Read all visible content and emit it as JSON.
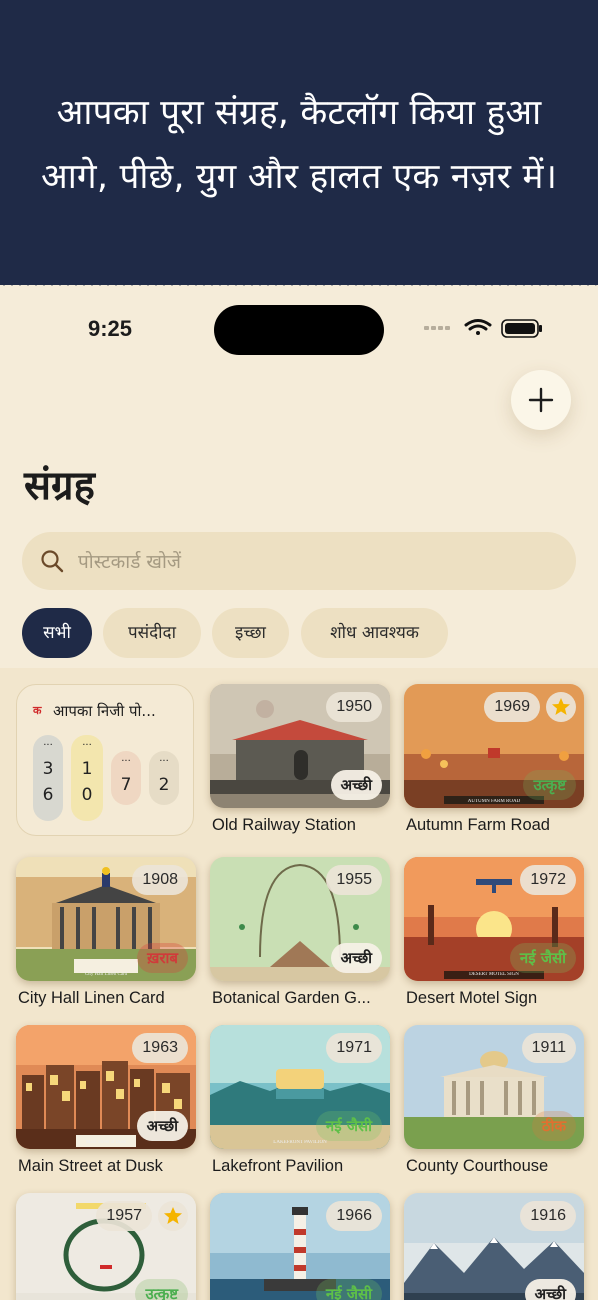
{
  "banner": {
    "line1": "आपका पूरा संग्रह, कैटलॉग किया हुआ",
    "line2": "आगे, पीछे, युग और हालत एक नज़र में।"
  },
  "status_bar": {
    "time": "9:25"
  },
  "header": {
    "title": "संग्रह",
    "add_icon": "plus-icon"
  },
  "search": {
    "placeholder": "पोस्टकार्ड खोजें",
    "value": "",
    "icon": "search-icon"
  },
  "filters": [
    {
      "label": "सभी",
      "active": true
    },
    {
      "label": "पसंदीदा",
      "active": false
    },
    {
      "label": "इच्छा",
      "active": false
    },
    {
      "label": "शोध आवश्यक",
      "active": false
    }
  ],
  "widget": {
    "glyph": "क",
    "title": "आपका निजी पो...",
    "pills": [
      {
        "top": "...",
        "a": "3",
        "b": "6",
        "color": "#d8d8d0"
      },
      {
        "top": "...",
        "a": "1",
        "b": "0",
        "color": "#f3e6ae"
      },
      {
        "top": "...",
        "a": "7",
        "b": "",
        "color": "#efd7c2"
      },
      {
        "top": "...",
        "a": "2",
        "b": "",
        "color": "#e6dcc6"
      }
    ]
  },
  "cards": [
    {
      "title": "Old Railway Station",
      "year": "1950",
      "condition": "अच्छी",
      "condition_type": "good",
      "favorite": false,
      "scene": "railway"
    },
    {
      "title": "Autumn Farm Road",
      "year": "1969",
      "condition": "उत्कृष्ट",
      "condition_type": "excellent",
      "favorite": true,
      "scene": "farm",
      "caption": "AUTUMN FARM ROAD"
    },
    {
      "title": "City Hall Linen Card",
      "year": "1908",
      "condition": "ख़राब",
      "condition_type": "poor",
      "favorite": false,
      "scene": "cityhall",
      "caption": "City Hall Linen Card"
    },
    {
      "title": "Botanical Garden G...",
      "year": "1955",
      "condition": "अच्छी",
      "condition_type": "good",
      "favorite": false,
      "scene": "garden"
    },
    {
      "title": "Desert Motel Sign",
      "year": "1972",
      "condition": "नई जैसी",
      "condition_type": "mint",
      "favorite": false,
      "scene": "desert",
      "caption": "DESERT MOTEL SIGN"
    },
    {
      "title": "Main Street at Dusk",
      "year": "1963",
      "condition": "अच्छी",
      "condition_type": "good",
      "favorite": false,
      "scene": "mainstreet",
      "caption": "Main Street at Dusk"
    },
    {
      "title": "Lakefront Pavilion",
      "year": "1971",
      "condition": "नई जैसी",
      "condition_type": "mint",
      "favorite": false,
      "scene": "lake",
      "caption": "LAKEFRONT PAVILION"
    },
    {
      "title": "County Courthouse",
      "year": "1911",
      "condition": "ठीक",
      "condition_type": "fair",
      "favorite": false,
      "scene": "courthouse"
    },
    {
      "title": "",
      "year": "1957",
      "condition": "उत्कृष्ट",
      "condition_type": "excellent",
      "favorite": true,
      "scene": "ring"
    },
    {
      "title": "",
      "year": "1966",
      "condition": "नई जैसी",
      "condition_type": "mint",
      "favorite": false,
      "scene": "lighthouse"
    },
    {
      "title": "",
      "year": "1916",
      "condition": "अच्छी",
      "condition_type": "good",
      "favorite": false,
      "scene": "mountains"
    }
  ],
  "colors": {
    "banner_bg": "#1f2a47",
    "page_bg": "#f5ecd9",
    "chip_active": "#1f2a47",
    "chip_bg": "#ede0c2",
    "star": "#f5b400"
  }
}
